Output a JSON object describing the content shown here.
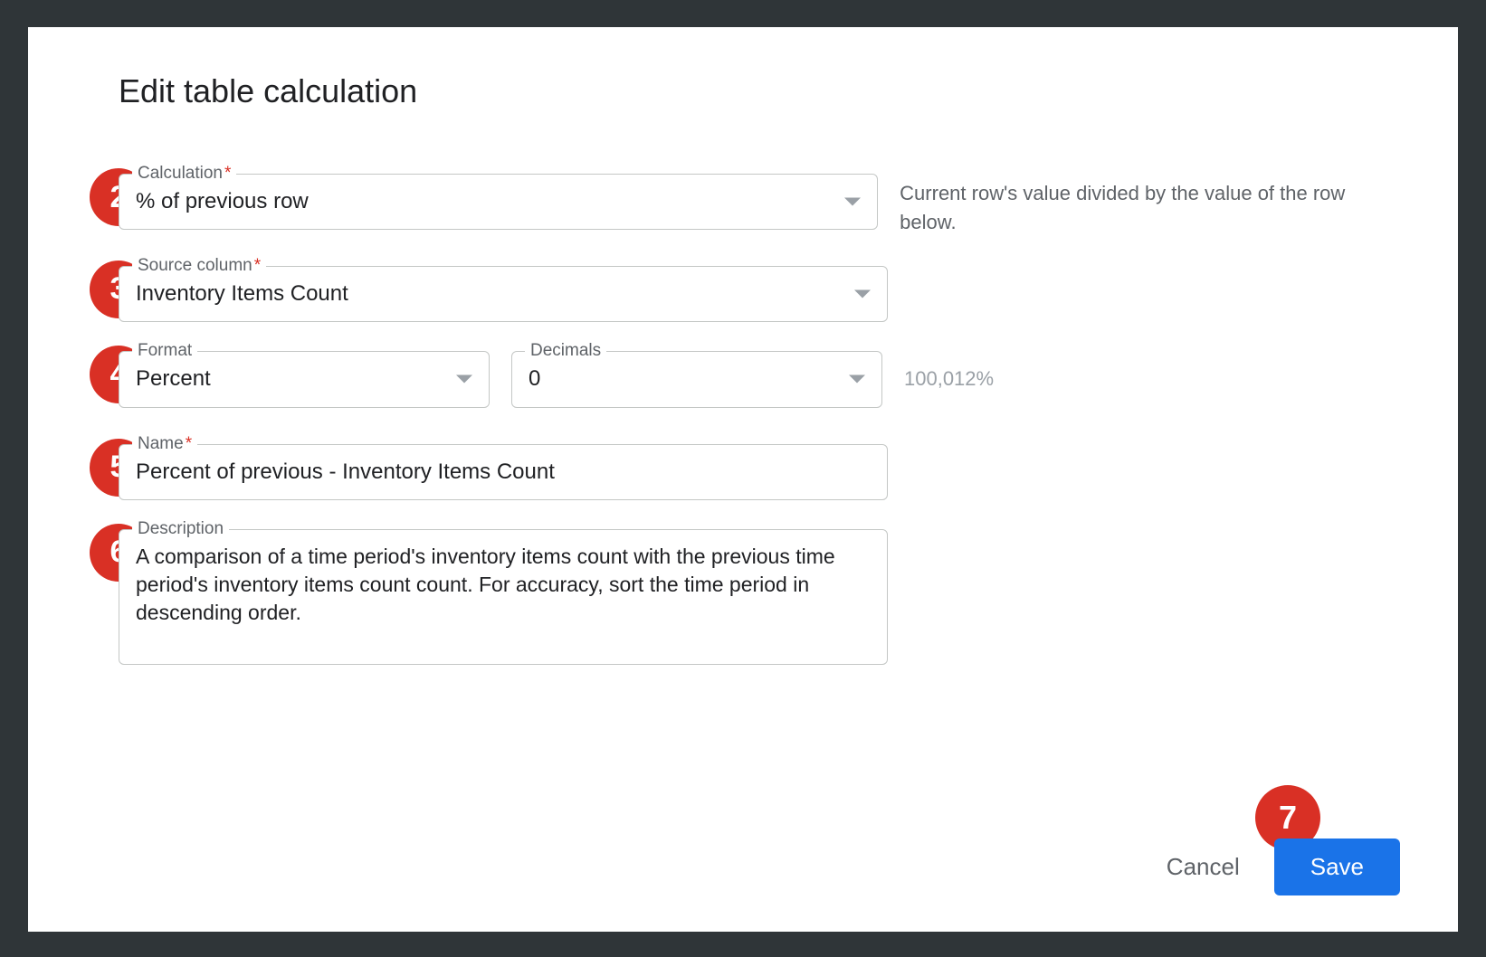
{
  "dialog": {
    "title": "Edit table calculation",
    "calculation": {
      "label": "Calculation",
      "required": true,
      "value": "% of previous row",
      "hint": "Current row's value divided by the value of the row below."
    },
    "source_column": {
      "label": "Source column",
      "required": true,
      "value": "Inventory Items Count"
    },
    "format": {
      "label": "Format",
      "value": "Percent"
    },
    "decimals": {
      "label": "Decimals",
      "value": "0"
    },
    "format_sample": "100,012%",
    "name": {
      "label": "Name",
      "required": true,
      "value": "Percent of previous -  Inventory Items Count"
    },
    "description": {
      "label": "Description",
      "value": "A comparison of a time period's inventory items count with the previous time period's inventory items count count. For accuracy, sort the time period in descending order."
    },
    "actions": {
      "cancel": "Cancel",
      "save": "Save"
    }
  },
  "annotations": {
    "n2": "2",
    "n3": "3",
    "n4": "4",
    "n5": "5",
    "n6": "6",
    "n7": "7"
  }
}
